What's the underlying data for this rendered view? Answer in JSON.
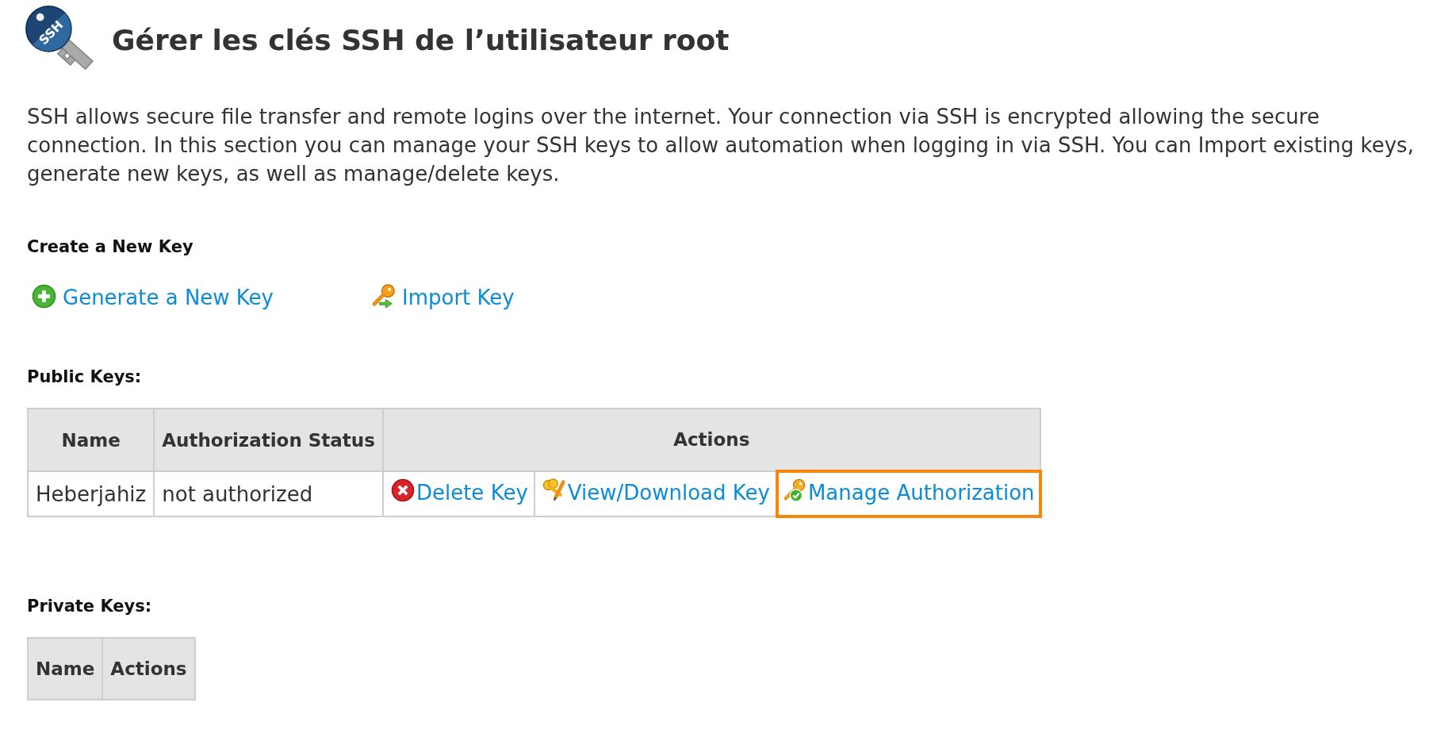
{
  "header": {
    "icon_text": "SSH",
    "title": "Gérer les clés SSH de l’utilisateur root"
  },
  "intro": "SSH allows secure file transfer and remote logins over the internet. Your connection via SSH is encrypted allowing the secure connection. In this section you can manage your SSH keys to allow automation when logging in via SSH. You can Import existing keys, generate new keys, as well as manage/delete keys.",
  "create_section": {
    "heading": "Create a New Key",
    "links": [
      {
        "kind": "add",
        "label": "Generate a New Key"
      },
      {
        "kind": "import",
        "label": "Import Key"
      }
    ]
  },
  "public_keys": {
    "heading": "Public Keys:",
    "columns": [
      "Name",
      "Authorization Status",
      "Actions"
    ],
    "rows": [
      {
        "name": "Heberjahiz",
        "status": "not authorized",
        "actions": [
          {
            "kind": "delete",
            "label": "Delete Key",
            "highlighted": false
          },
          {
            "kind": "view",
            "label": "View/Download Key",
            "highlighted": false
          },
          {
            "kind": "authorize",
            "label": "Manage Authorization",
            "highlighted": true
          }
        ]
      }
    ]
  },
  "private_keys": {
    "heading": "Private Keys:",
    "columns": [
      "Name",
      "Actions"
    ]
  }
}
